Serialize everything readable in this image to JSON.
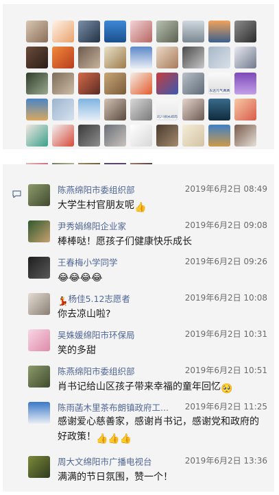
{
  "likes": {
    "avatars": [
      {
        "bg": "linear-gradient(135deg,#d8c7b4,#8a6e57)"
      },
      {
        "bg": "linear-gradient(135deg,#fff3ea,#e8a26c)"
      },
      {
        "bg": "linear-gradient(135deg,#7a8fa8,#233245)"
      },
      {
        "bg": "linear-gradient(180deg,#3d88d6,#1b4f8c)"
      },
      {
        "bg": "linear-gradient(135deg,#f3d3d7,#b6675f)"
      },
      {
        "bg": "linear-gradient(135deg,#b9c1b2,#5a6150)"
      },
      {
        "bg": "linear-gradient(180deg,#cfd8de,#7b8892)"
      },
      {
        "bg": "linear-gradient(180deg,#f0a25a,#3b5f8c)"
      },
      {
        "bg": "linear-gradient(135deg,#8d8d8d,#2c2c2c)"
      },
      {
        "bg": "linear-gradient(135deg,#6b4b3a,#2b1d16)"
      },
      {
        "bg": "linear-gradient(135deg,#f08a3c,#b83d1f)"
      },
      {
        "bg": "linear-gradient(135deg,#6b5a4e,#c8b39c)"
      },
      {
        "bg": "linear-gradient(135deg,#e7e1c8,#9d7b4c)"
      },
      {
        "bg": "linear-gradient(180deg,#5c88c9,#e9eef5)"
      },
      {
        "bg": "linear-gradient(135deg,#ead9c7,#a87b5b)"
      },
      {
        "bg": "linear-gradient(135deg,#4a4a4a,#c8c8c8)"
      },
      {
        "bg": "linear-gradient(135deg,#a8b8c8,#d8e0e8)"
      },
      {
        "bg": "linear-gradient(135deg,#e9e9f2,#707a8c)"
      },
      {
        "bg": "linear-gradient(135deg,#2f3d2b,#9aa98f)"
      },
      {
        "bg": "linear-gradient(135deg,#7d6c5a,#cdbca5)"
      },
      {
        "bg": "linear-gradient(135deg,#d46a4a,#5a2b22)"
      },
      {
        "bg": "linear-gradient(135deg,#c7a777,#7a5b3a)"
      },
      {
        "bg": "linear-gradient(135deg,#f3efe6,#e35b2c)"
      },
      {
        "bg": "linear-gradient(135deg,#c63d3d,#3a5ab0)"
      },
      {
        "bg": "linear-gradient(135deg,#b9c0c8,#5e6b78)"
      },
      {
        "bg": "linear-gradient(180deg,#fafafa,#dcdcdc)",
        "label": "永远元气满满!"
      },
      {
        "bg": "linear-gradient(180deg,#7d4ab8,#c2a0e6)"
      },
      {
        "bg": "linear-gradient(180deg,#4a86c6,#d8a860)"
      },
      {
        "bg": "linear-gradient(135deg,#9bb4cf,#d7e2ee)"
      },
      {
        "bg": "linear-gradient(180deg,#7fb3e0,#e7eff7)"
      },
      {
        "bg": "linear-gradient(135deg,#d2c2b4,#5a4a3e)"
      },
      {
        "bg": "linear-gradient(135deg,#d8d8d8,#7a7a7a)"
      },
      {
        "bg": "linear-gradient(180deg,#f7f7f7,#e6e6e6)",
        "label": "北川县民政局"
      },
      {
        "bg": "linear-gradient(135deg,#e6d5cb,#6b5a52)"
      },
      {
        "bg": "linear-gradient(180deg,#3a6b8c,#0f2b3d)"
      },
      {
        "bg": "linear-gradient(135deg,#f7c9a5,#d85b4b)"
      },
      {
        "bg": "linear-gradient(135deg,#f0e8e0,#3aa08c)"
      },
      {
        "bg": "linear-gradient(135deg,#f2f2f2,#d64a3a)"
      },
      {
        "bg": "linear-gradient(135deg,#3a3a3a,#8e8e8e)"
      },
      {
        "bg": "linear-gradient(135deg,#6b6f78,#c8c4bd)"
      },
      {
        "bg": "linear-gradient(135deg,#ffffff,#d8d8d8)"
      },
      {
        "bg": "linear-gradient(135deg,#4a3a2e,#a48a6f)"
      },
      {
        "bg": "linear-gradient(135deg,#f5ecd8,#d3c3a3)"
      },
      {
        "bg": "linear-gradient(180deg,#3f7fc4,#cc9a4a)"
      },
      {
        "bg": "linear-gradient(135deg,#7a5a4a,#e6e0da)"
      },
      {
        "bg": "linear-gradient(135deg,#f0e7d8,#c94a6a)"
      },
      {
        "bg": "linear-gradient(135deg,#4a5e3a,#d0c9b0)"
      },
      {
        "bg": "linear-gradient(135deg,#b8a67a,#5a4a2e)"
      },
      {
        "bg": "linear-gradient(180deg,#8a6a9a,#3a2a4a)"
      },
      {
        "bg": "linear-gradient(135deg,#c89a8a,#3a2a2a)"
      }
    ]
  },
  "comments": [
    {
      "name": "陈燕绵阳市委组织部",
      "time": "2019年6月2日 08:49",
      "text": "大学生村官朋友呢",
      "suffix": "👍",
      "av": "linear-gradient(135deg,#8d9a6a,#3f4a2e)"
    },
    {
      "name": "尹秀娟绵阳企业家",
      "time": "2019年6月2日 09:08",
      "text": "棒棒哒！愿孩子们健康快乐成长",
      "av": "linear-gradient(135deg,#2f5a2e,#c8a070)"
    },
    {
      "name": "王春梅小学同学",
      "time": "2019年6月2日 09:26",
      "emojis": [
        "😂",
        "😂",
        "😂",
        "😂"
      ],
      "av": "linear-gradient(135deg,#1e1e1e,#5a5a5a)"
    },
    {
      "name": "杨佳5.12志愿者",
      "prefix": "💃",
      "time": "2019年6月2日 10:08",
      "text": "你去凉山啦?",
      "av": "linear-gradient(135deg,#e4ddd5,#8a7e72)"
    },
    {
      "name": "吴姝媛绵阳市环保局",
      "time": "2019年6月2日 10:31",
      "text": "笑的多甜",
      "av": "linear-gradient(135deg,#f7d7e5,#e08aa8)"
    },
    {
      "name": "陈燕绵阳市委组织部",
      "time": "2019年6月2日 10:51",
      "text": "肖书记给山区孩子带来幸福的童年回忆",
      "suffix": "🥺",
      "av": "linear-gradient(135deg,#8d9a6a,#3f4a2e)"
    },
    {
      "name": "陈雨菡木里茶布朗镇政府工...",
      "time": "2019年6月2日 11:25",
      "text": "感谢爱心慈善家，感谢肖书记，感谢党和政府的好政策！",
      "suffix": "👍👍👍",
      "av": "linear-gradient(180deg,#3a78c8,#e9eef4)"
    },
    {
      "name": "周大文绵阳市广播电视台",
      "time": "2019年6月2日 13:36",
      "text": "满满的节日氛围，赞一个！",
      "av": "linear-gradient(135deg,#7a8a3a,#2f3a1e)"
    }
  ]
}
